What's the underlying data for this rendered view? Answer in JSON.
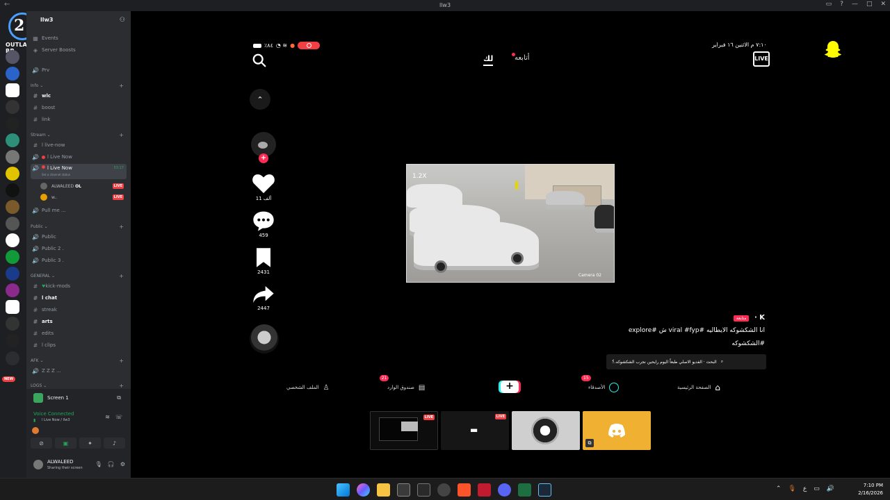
{
  "window": {
    "title": "llw3"
  },
  "guild": {
    "name": "llw3",
    "logo_text": "OUTLAW RP",
    "logo_number": "2"
  },
  "channels": {
    "top": [
      {
        "icon": "calendar-icon",
        "label": "Events"
      },
      {
        "icon": "boost-icon",
        "label": "Server Boosts"
      },
      {
        "icon": "speaker-icon",
        "label": "Prv"
      }
    ],
    "info": {
      "title": "Info",
      "items": [
        "wlc",
        "boost",
        "link"
      ]
    },
    "stream": {
      "title": "Stream",
      "items": [
        "l live-now",
        "l Live Now",
        "l Live Now"
      ],
      "active_timer": "53:17",
      "channel_status": "Set a channel status",
      "members": [
        {
          "name": "ALWALEED",
          "tag": "OL",
          "live": "LIVE"
        },
        {
          "name": "w..",
          "live": "LIVE"
        }
      ],
      "extra": "Pull me ..."
    },
    "public": {
      "title": "Public",
      "items": [
        "Public",
        "Public 2 .",
        "Public 3 ."
      ]
    },
    "general": {
      "title": "GENERAL",
      "items": [
        "kick-mods",
        "l chat",
        "streak",
        "arts",
        "edits",
        "l clips"
      ]
    },
    "afk": {
      "title": "AFK",
      "items": [
        "Z Z Z",
        "..."
      ]
    },
    "logs": {
      "title": "LOGS"
    }
  },
  "server_badges": {
    "new": "NEW"
  },
  "voice_panel": {
    "screen_label": "Screen 1",
    "status": "Voice Connected",
    "location": "l Live Now / llw3",
    "user_name": "ALWALEED",
    "user_status": "Sharing their screen"
  },
  "stream_view": {
    "phone_status_left": "٪٨٤",
    "phone_status_right": "٧:١٠ م  الاثنين ١٦ فبراير",
    "tab_for_you": "لك",
    "tab_following": "أتابعه",
    "live_label": "LIVE",
    "video_zoom": "1.2X",
    "video_camera": "Camera 02",
    "actions": [
      {
        "icon": "heart-icon",
        "count": "11 ألف"
      },
      {
        "icon": "comment-icon",
        "count": "459"
      },
      {
        "icon": "bookmark-icon",
        "count": "2431"
      },
      {
        "icon": "share-icon",
        "count": "2447"
      }
    ],
    "caption_user": "K",
    "caption_follow": "متابعة",
    "caption_line1": "انا الشكشوكه الايطاليه #viral #fyp ش #explore",
    "caption_line2": "#الشكشوكه",
    "search_suggestion": "البحث · الفديو الاصلي طبعاً اليوم رايحين نجرب الشكشوكه...",
    "bottom_nav": [
      {
        "label": "الصفحة الرئيسية",
        "icon": "home-icon"
      },
      {
        "label": "الأصدقاء",
        "icon": "friends-icon",
        "badge": "15"
      },
      {
        "label": "صندوق الوارد",
        "icon": "inbox-icon",
        "badge": "21"
      },
      {
        "label": "الملف الشخصي",
        "icon": "profile-icon"
      }
    ],
    "plus_label": "+"
  },
  "participants": [
    {
      "name": "screen-share-1",
      "live": "LIVE",
      "bg": "#0d0d0d"
    },
    {
      "name": "screen-share-2",
      "live": "LIVE",
      "bg": "#161616"
    },
    {
      "name": "user-tile",
      "bg": "#cfcfcf"
    },
    {
      "name": "discord-tile",
      "bg": "#f0b132"
    }
  ],
  "taskbar": {
    "time": "7:10 PM",
    "date": "2/16/2026",
    "lang": "ع"
  },
  "colors": {
    "accent_red": "#f23f43",
    "tiktok_red": "#fe2c55",
    "tiktok_cyan": "#25f4ee",
    "discord_green": "#23a55a",
    "snap_yellow": "#fffc00"
  }
}
